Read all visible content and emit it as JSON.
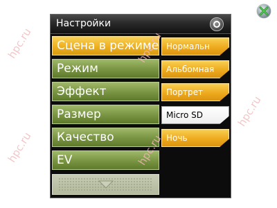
{
  "window": {
    "title": "Настройки"
  },
  "menu": {
    "options": [
      {
        "label": "Сцена в режиме",
        "selected": true
      },
      {
        "label": "Режим",
        "selected": false
      },
      {
        "label": "Эффект",
        "selected": false
      },
      {
        "label": "Размер",
        "selected": false
      },
      {
        "label": "Качество",
        "selected": false
      },
      {
        "label": "EV",
        "selected": false
      }
    ]
  },
  "submenu": {
    "items": [
      {
        "label": "Нормальн",
        "active": false
      },
      {
        "label": "Альбомная",
        "active": false
      },
      {
        "label": "Портрет",
        "active": false
      },
      {
        "label": "Micro SD",
        "active": true
      },
      {
        "label": "Ночь",
        "active": false
      }
    ]
  },
  "watermark": "hpc.ru",
  "colors": {
    "selected": "#f0b324",
    "option": "#7f9a48",
    "title_bar": "#2a2a2a",
    "submenu_active": "#ffffff"
  },
  "icons": {
    "close": "close-x-icon",
    "ok": "ok-circle-icon",
    "scroll": "scroll-down-arrow-icon"
  }
}
